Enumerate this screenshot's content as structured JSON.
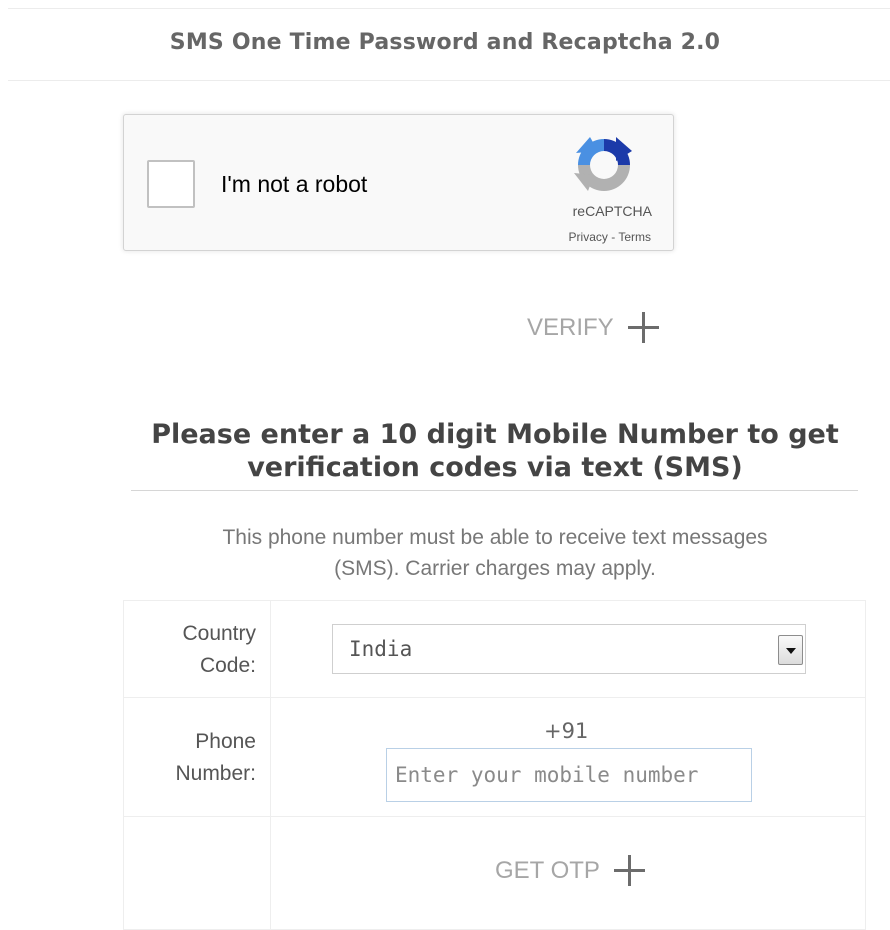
{
  "header": {
    "title": "SMS One Time Password and Recaptcha 2.0"
  },
  "recaptcha": {
    "label": "I'm not a robot",
    "brand": "reCAPTCHA",
    "privacy": "Privacy",
    "separator": " - ",
    "terms": "Terms"
  },
  "verify": {
    "label": "VERIFY"
  },
  "section": {
    "title_line1": "Please enter a 10 digit Mobile Number to get",
    "title_line2": "verification codes via text (SMS)",
    "subtitle_line1": "This phone number must be able to receive text messages",
    "subtitle_line2": "(SMS). Carrier charges may apply."
  },
  "form": {
    "country_label_line1": "Country",
    "country_label_line2": "Code:",
    "country_value": "India",
    "phone_label_line1": "Phone",
    "phone_label_line2": "Number:",
    "phone_prefix": "+91",
    "phone_placeholder": "Enter your mobile number",
    "get_otp_label": "GET OTP"
  },
  "colors": {
    "accent_blue": "#1c3aa9",
    "accent_light_blue": "#4a90e2",
    "gray": "#b1b1b1"
  }
}
